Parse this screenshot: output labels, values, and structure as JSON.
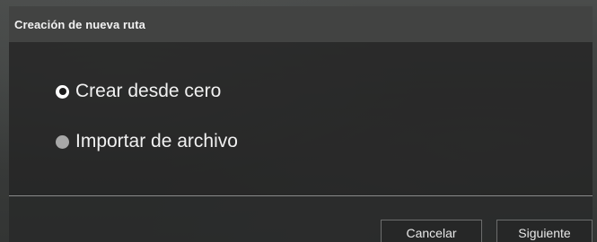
{
  "dialog": {
    "title": "Creación de nueva ruta",
    "options": [
      {
        "label": "Crear desde cero",
        "selected": true
      },
      {
        "label": "Importar de archivo",
        "selected": false
      }
    ],
    "buttons": {
      "cancel": "Cancelar",
      "next": "Siguiente"
    }
  }
}
